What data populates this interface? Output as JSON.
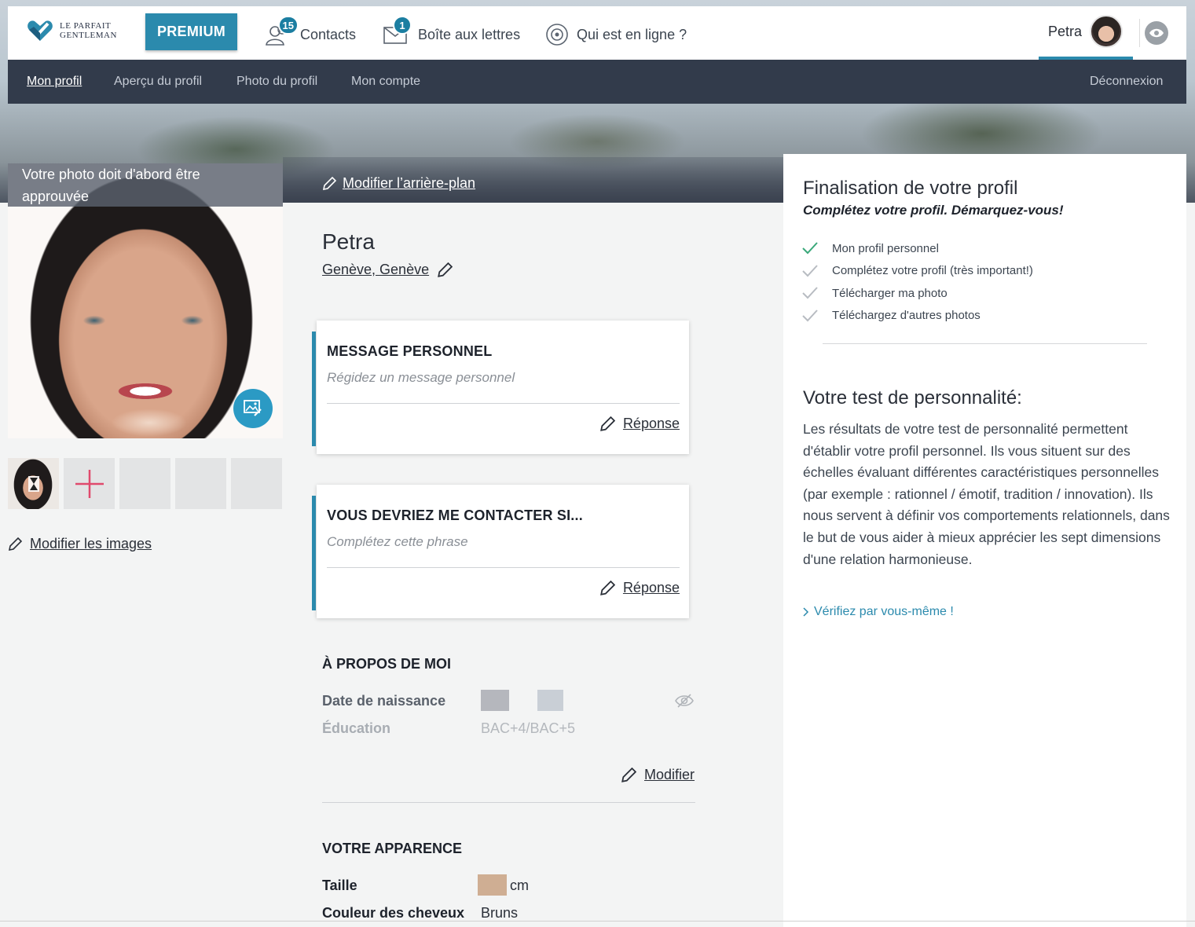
{
  "topnav": {
    "logo_line1": "LE PARFAIT",
    "logo_line2": "GENTLEMAN",
    "premium_label": "PREMIUM",
    "contacts_label": "Contacts",
    "contacts_badge": "15",
    "mailbox_label": "Boîte aux lettres",
    "mailbox_badge": "1",
    "online_label": "Qui est en ligne ?",
    "user_name": "Petra"
  },
  "subnav": {
    "items": [
      "Mon profil",
      "Aperçu du profil",
      "Photo du profil",
      "Mon compte"
    ],
    "logout": "Déconnexion"
  },
  "photo": {
    "banner": "Votre photo doit d'abord être approuvée",
    "edit_images": "Modifier les images"
  },
  "profile": {
    "edit_background": "Modifier l’arrière-plan",
    "name": "Petra",
    "location": "Genève, Genève"
  },
  "cards": [
    {
      "title": "MESSAGE PERSONNEL",
      "placeholder": "Régidez un message personnel",
      "action": "Réponse"
    },
    {
      "title": "VOUS DEVRIEZ ME CONTACTER SI...",
      "placeholder": "Complétez cette phrase",
      "action": "Réponse"
    }
  ],
  "about": {
    "title": "À PROPOS DE MOI",
    "birth_label": "Date de naissance",
    "education_label": "Éducation",
    "education_value": "BAC+4/BAC+5",
    "edit": "Modifier"
  },
  "appearance": {
    "title": "VOTRE APPARENCE",
    "height_label": "Taille",
    "height_unit": "cm",
    "hair_label": "Couleur des cheveux",
    "hair_value": "Bruns"
  },
  "completion": {
    "title": "Finalisation de votre profil",
    "subtitle": "Complétez votre profil. Démarquez-vous!",
    "items": [
      {
        "label": "Mon profil personnel",
        "done": true
      },
      {
        "label": "Complétez votre profil (très important!)",
        "done": false
      },
      {
        "label": "Télécharger ma photo",
        "done": false
      },
      {
        "label": "Téléchargez d'autres photos",
        "done": false
      }
    ]
  },
  "personality": {
    "title": "Votre test de personnalité:",
    "text": "Les résultats de votre test de personnalité permettent d'établir votre profil personnel. Ils vous situent sur des échelles évaluant différentes caractéristiques personnelles (par exemple : rationnel / émotif, tradition / innovation). Ils nous servent à définir vos comportements relationnels, dans le but de vous aider à mieux apprécier les sept dimensions d'une relation harmonieuse.",
    "link": "Vérifiez par vous-même !"
  },
  "colors": {
    "accent": "#2b8aad",
    "subnav_bg": "#323b4b",
    "check_done": "#3aa87a",
    "check_todo": "#b8bcc2"
  }
}
